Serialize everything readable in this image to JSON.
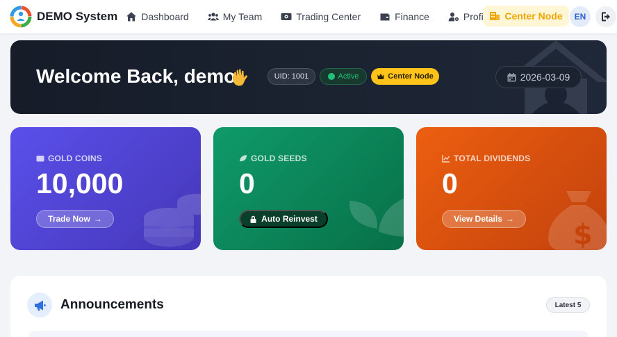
{
  "brand": {
    "name": "DEMO System"
  },
  "nav": {
    "items": [
      {
        "label": "Dashboard",
        "icon": "home-icon"
      },
      {
        "label": "My Team",
        "icon": "users-icon"
      },
      {
        "label": "Trading Center",
        "icon": "exchange-icon"
      },
      {
        "label": "Finance",
        "icon": "wallet-icon"
      },
      {
        "label": "Profile",
        "icon": "user-gear-icon"
      }
    ],
    "node_label": "Center Node",
    "lang": "EN"
  },
  "welcome": {
    "title": "Welcome Back, demo",
    "uid": "UID: 1001",
    "status": "Active",
    "node": "Center Node",
    "date": "2026-03-09"
  },
  "stats": [
    {
      "label": "GOLD COINS",
      "value": "10,000",
      "action": "Trade Now",
      "color": "#5a4fea"
    },
    {
      "label": "GOLD SEEDS",
      "value": "0",
      "action": "Auto Reinvest",
      "color": "#0f9a6a"
    },
    {
      "label": "TOTAL DIVIDENDS",
      "value": "0",
      "action": "View Details",
      "color": "#ec5f10"
    }
  ],
  "announcements": {
    "title": "Announcements",
    "badge": "Latest 5"
  },
  "colors": {
    "accent": "#f0a500",
    "banner": "#161c28",
    "link": "#2f6ee0"
  }
}
